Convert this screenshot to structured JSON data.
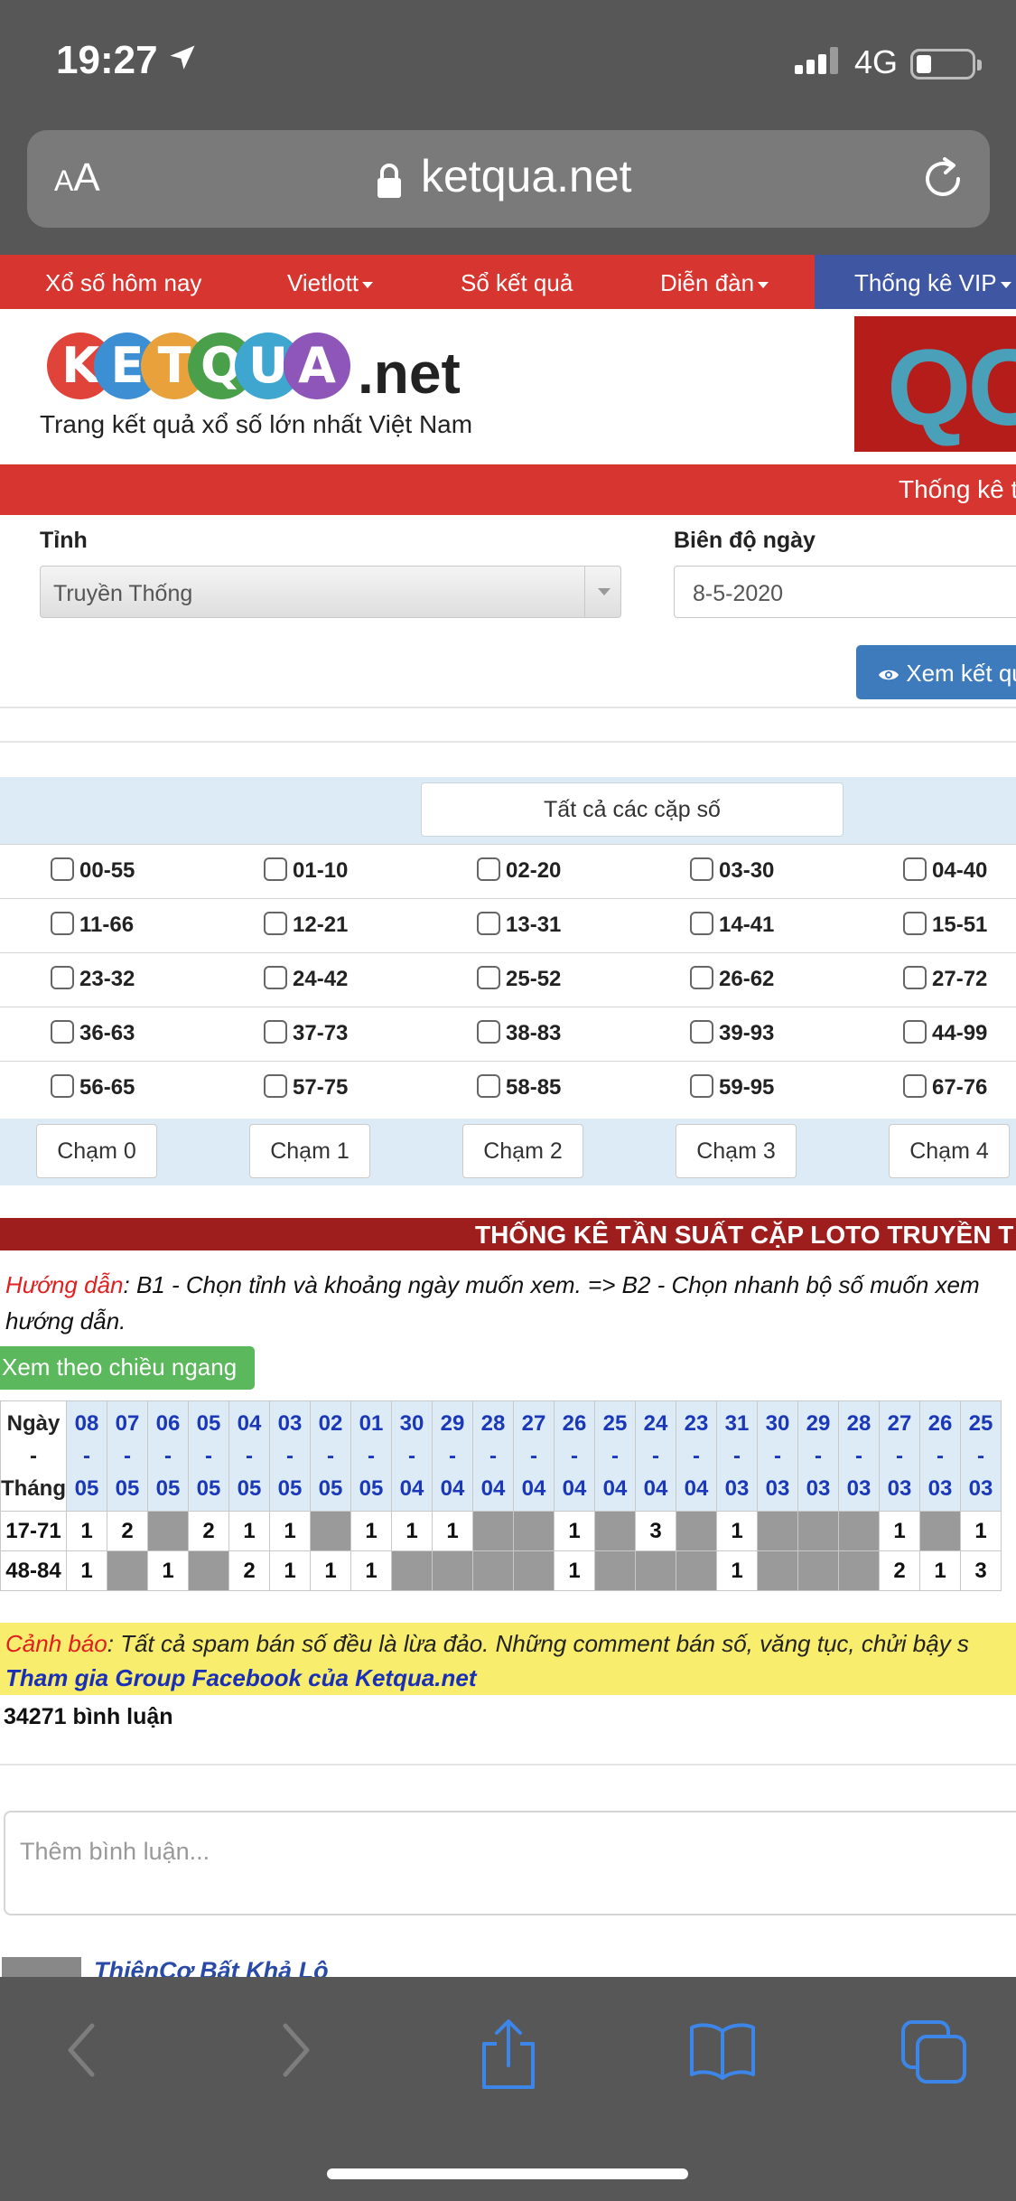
{
  "status_bar": {
    "time": "19:27",
    "network": "4G"
  },
  "browser": {
    "text_size_label": "AA",
    "domain": "ketqua.net"
  },
  "nav": {
    "items": [
      {
        "label": "Xổ số hôm nay"
      },
      {
        "label": "Vietlott"
      },
      {
        "label": "Sổ kết quả"
      },
      {
        "label": "Diễn đàn"
      },
      {
        "label": "Thống kê VIP"
      }
    ]
  },
  "header": {
    "logo_letters": [
      "K",
      "E",
      "T",
      "Q",
      "U",
      "A"
    ],
    "logo_colors": [
      "#e0433a",
      "#3d8fd4",
      "#e9a23b",
      "#4aa04a",
      "#3fa6d0",
      "#8e56b8"
    ],
    "logo_suffix": ".net",
    "tagline": "Trang kết quả xổ số lớn nhất Việt Nam",
    "banner_text": "QC",
    "section_bar": "Thống kê t"
  },
  "form": {
    "province_label": "Tỉnh",
    "province_value": "Truyền Thống",
    "range_label": "Biên độ ngày",
    "range_value": "8-5-2020",
    "view_button": "Xem kết qu"
  },
  "pairs": {
    "all_button": "Tất cả các cặp số",
    "rows": [
      [
        "00-55",
        "01-10",
        "02-20",
        "03-30",
        "04-40"
      ],
      [
        "11-66",
        "12-21",
        "13-31",
        "14-41",
        "15-51"
      ],
      [
        "23-32",
        "24-42",
        "25-52",
        "26-62",
        "27-72"
      ],
      [
        "36-63",
        "37-73",
        "38-83",
        "39-93",
        "44-99"
      ],
      [
        "56-65",
        "57-75",
        "58-85",
        "59-95",
        "67-76"
      ]
    ],
    "cham_buttons": [
      "Chạm 0",
      "Chạm 1",
      "Chạm 2",
      "Chạm 3",
      "Chạm 4"
    ]
  },
  "stats": {
    "title": "THỐNG KÊ TẦN SUẤT CẶP LOTO TRUYỀN T",
    "guide_prefix": "Hướng dẫn",
    "guide_text": ": B1 - Chọn tỉnh và khoảng ngày muốn xem. => B2 - Chọn nhanh bộ số muốn xem",
    "guide_text2": "hướng dẫn.",
    "horizontal_button": "Xem theo chiều ngang"
  },
  "freq_table": {
    "header_top": "Ngày",
    "header_mid": "-",
    "header_bottom": "Tháng",
    "days": [
      "08",
      "07",
      "06",
      "05",
      "04",
      "03",
      "02",
      "01",
      "30",
      "29",
      "28",
      "27",
      "26",
      "25",
      "24",
      "23",
      "31",
      "30",
      "29",
      "28",
      "27",
      "26",
      "25"
    ],
    "months": [
      "05",
      "05",
      "05",
      "05",
      "05",
      "05",
      "05",
      "05",
      "04",
      "04",
      "04",
      "04",
      "04",
      "04",
      "04",
      "04",
      "03",
      "03",
      "03",
      "03",
      "03",
      "03",
      "03"
    ],
    "rows": [
      {
        "pair": "17-71",
        "values": [
          "1",
          "2",
          "",
          "2",
          "1",
          "1",
          "",
          "1",
          "1",
          "1",
          "",
          "",
          "1",
          "",
          "3",
          "",
          "1",
          "",
          "",
          "",
          "1",
          "",
          "1"
        ]
      },
      {
        "pair": "48-84",
        "values": [
          "1",
          "",
          "1",
          "",
          "2",
          "1",
          "1",
          "1",
          "",
          "",
          "",
          "",
          "1",
          "",
          "",
          "",
          "1",
          "",
          "",
          "",
          "2",
          "1",
          "3"
        ]
      }
    ]
  },
  "comments": {
    "warning_prefix": "Cảnh báo",
    "warning_text": ": Tất cả spam bán số đều là lừa đảo. Những comment bán số, văng tục, chửi bậy s",
    "facebook_link": "Tham gia Group Facebook của Ketqua.net",
    "count_text": "34271 bình luận",
    "input_placeholder": "Thêm bình luận...",
    "first_user": "ThiênCơ Bất Khả Lộ"
  }
}
